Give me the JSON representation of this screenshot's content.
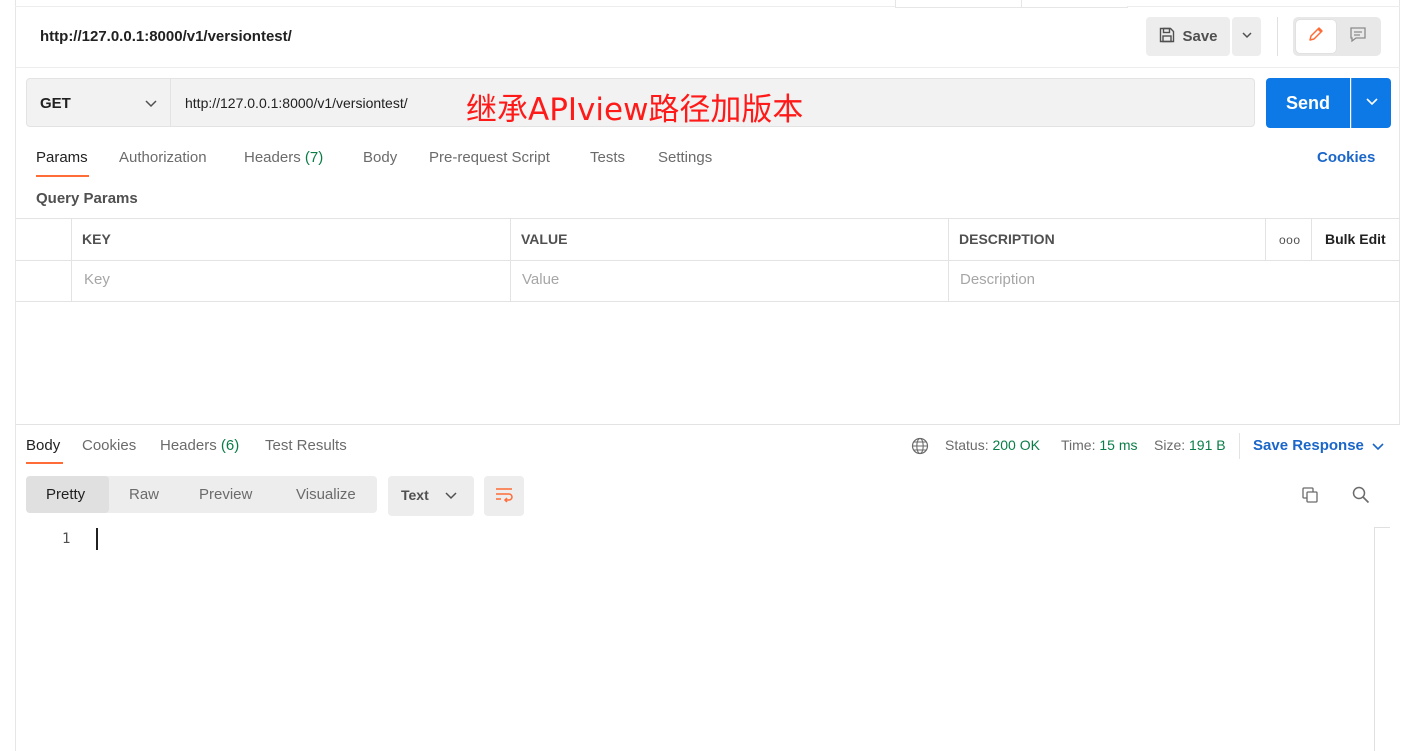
{
  "header": {
    "title": "http://127.0.0.1:8000/v1/versiontest/",
    "save_label": "Save"
  },
  "request": {
    "method": "GET",
    "url": "http://127.0.0.1:8000/v1/versiontest/",
    "annotation": "继承APIview路径加版本",
    "send_label": "Send"
  },
  "request_tabs": [
    {
      "label": "Params",
      "count": ""
    },
    {
      "label": "Authorization",
      "count": ""
    },
    {
      "label": "Headers",
      "count": "(7)"
    },
    {
      "label": "Body",
      "count": ""
    },
    {
      "label": "Pre-request Script",
      "count": ""
    },
    {
      "label": "Tests",
      "count": ""
    },
    {
      "label": "Settings",
      "count": ""
    }
  ],
  "cookies_label": "Cookies",
  "query_params": {
    "title": "Query Params",
    "columns": [
      "KEY",
      "VALUE",
      "DESCRIPTION"
    ],
    "placeholders": [
      "Key",
      "Value",
      "Description"
    ],
    "more_icon": "ooo",
    "bulk_edit_label": "Bulk Edit"
  },
  "response": {
    "tabs": [
      {
        "label": "Body",
        "count": ""
      },
      {
        "label": "Cookies",
        "count": ""
      },
      {
        "label": "Headers",
        "count": "(6)"
      },
      {
        "label": "Test Results",
        "count": ""
      }
    ],
    "status_label": "Status:",
    "status_value": "200 OK",
    "time_label": "Time:",
    "time_value": "15 ms",
    "size_label": "Size:",
    "size_value": "191 B",
    "save_response_label": "Save Response",
    "view_modes": [
      "Pretty",
      "Raw",
      "Preview",
      "Visualize"
    ],
    "format": "Text",
    "line_number": "1"
  },
  "colors": {
    "accent": "#ff6c37",
    "send": "#0c79e6",
    "link": "#1a66c9",
    "success": "#0a7d47",
    "annotation": "#ff1a1a"
  },
  "icons": [
    "save-icon",
    "chevron-down-icon",
    "pencil-icon",
    "comment-icon",
    "globe-icon",
    "wrap-lines-icon",
    "copy-icon",
    "search-icon"
  ]
}
